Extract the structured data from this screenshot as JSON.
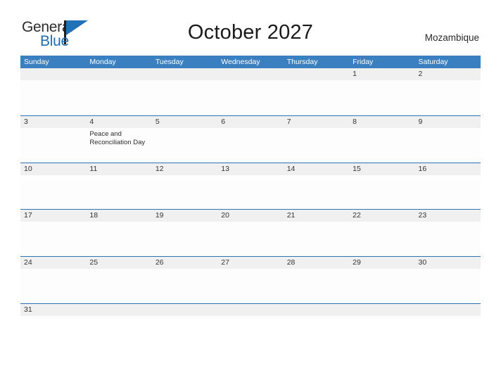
{
  "brand": {
    "name_part1": "General",
    "name_part2": "Blue",
    "flag_icon": "blue-flag-icon",
    "color_dark": "#2b2b2b",
    "color_blue": "#1f6cb0"
  },
  "header": {
    "title": "October 2027",
    "country": "Mozambique"
  },
  "theme": {
    "header_blue": "#3a7fc0",
    "rule_blue": "#2e74b5",
    "date_strip_gray": "#f0f0f0",
    "cell_white": "#fdfdfd"
  },
  "calendar": {
    "month": "October",
    "year": "2027",
    "weekday_headers": [
      "Sunday",
      "Monday",
      "Tuesday",
      "Wednesday",
      "Thursday",
      "Friday",
      "Saturday"
    ],
    "weeks": [
      {
        "dates": [
          "",
          "",
          "",
          "",
          "",
          "1",
          "2"
        ],
        "events": [
          "",
          "",
          "",
          "",
          "",
          "",
          ""
        ]
      },
      {
        "dates": [
          "3",
          "4",
          "5",
          "6",
          "7",
          "8",
          "9"
        ],
        "events": [
          "",
          "Peace and Reconciliation Day",
          "",
          "",
          "",
          "",
          ""
        ]
      },
      {
        "dates": [
          "10",
          "11",
          "12",
          "13",
          "14",
          "15",
          "16"
        ],
        "events": [
          "",
          "",
          "",
          "",
          "",
          "",
          ""
        ]
      },
      {
        "dates": [
          "17",
          "18",
          "19",
          "20",
          "21",
          "22",
          "23"
        ],
        "events": [
          "",
          "",
          "",
          "",
          "",
          "",
          ""
        ]
      },
      {
        "dates": [
          "24",
          "25",
          "26",
          "27",
          "28",
          "29",
          "30"
        ],
        "events": [
          "",
          "",
          "",
          "",
          "",
          "",
          ""
        ]
      },
      {
        "dates": [
          "31",
          "",
          "",
          "",
          "",
          "",
          ""
        ],
        "events": [
          "",
          "",
          "",
          "",
          "",
          "",
          ""
        ]
      }
    ]
  }
}
